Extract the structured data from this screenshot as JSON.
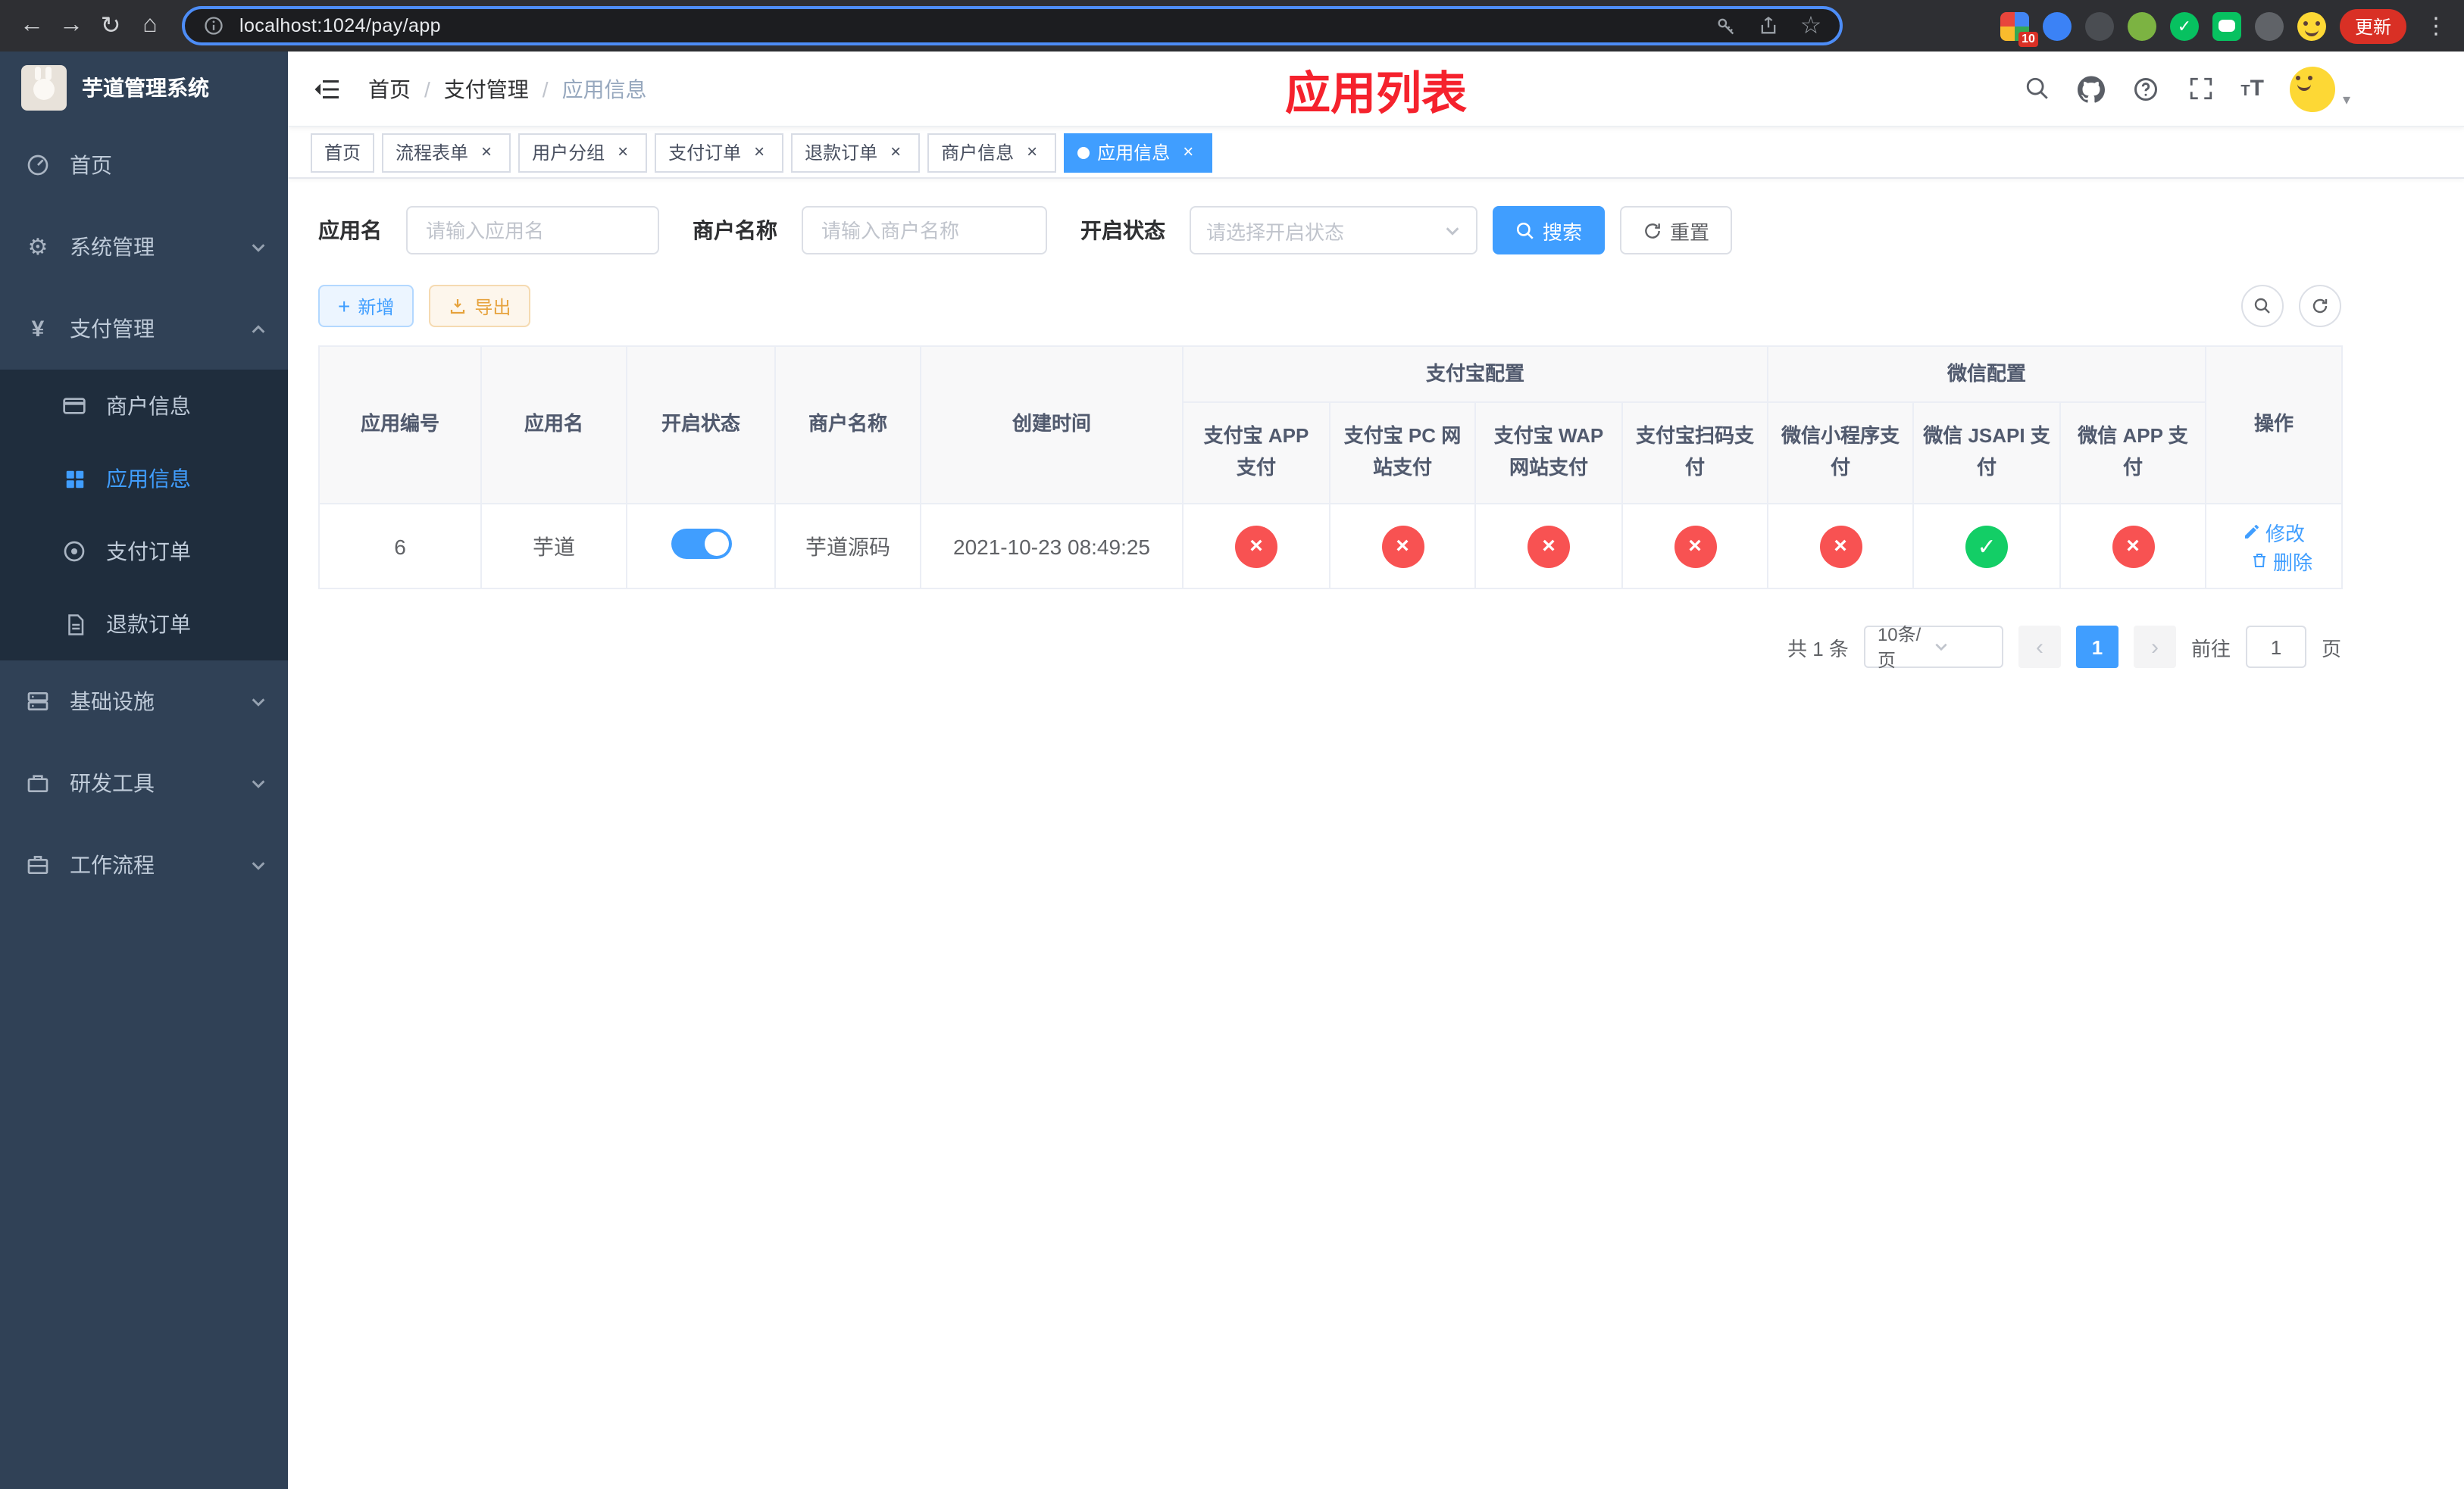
{
  "browser": {
    "url": "localhost:1024/pay/app",
    "ext_badge": "10",
    "update_label": "更新"
  },
  "colors": {
    "accent": "#409eff",
    "danger": "#f85252",
    "success": "#13ce66",
    "warning": "#e6a23c",
    "title_red": "#f5222d",
    "sidebar_bg": "#304156",
    "submenu_bg": "#1f2d3d"
  },
  "sidebar": {
    "title": "芋道管理系统",
    "items": [
      {
        "label": "首页",
        "icon": "dashboard-icon"
      },
      {
        "label": "系统管理",
        "icon": "gear-icon",
        "expandable": true,
        "expanded": false
      },
      {
        "label": "支付管理",
        "icon": "yen-icon",
        "expandable": true,
        "expanded": true,
        "children": [
          {
            "label": "商户信息",
            "icon": "card-icon",
            "active": false
          },
          {
            "label": "应用信息",
            "icon": "grid-icon",
            "active": true
          },
          {
            "label": "支付订单",
            "icon": "order-icon",
            "active": false
          },
          {
            "label": "退款订单",
            "icon": "refund-icon",
            "active": false
          }
        ]
      },
      {
        "label": "基础设施",
        "icon": "infra-icon",
        "expandable": true,
        "expanded": false
      },
      {
        "label": "研发工具",
        "icon": "tools-icon",
        "expandable": true,
        "expanded": false
      },
      {
        "label": "工作流程",
        "icon": "workflow-icon",
        "expandable": true,
        "expanded": false
      }
    ]
  },
  "header": {
    "breadcrumb": [
      "首页",
      "支付管理",
      "应用信息"
    ],
    "page_title": "应用列表"
  },
  "tabs": [
    {
      "label": "首页",
      "closable": false,
      "active": false
    },
    {
      "label": "流程表单",
      "closable": true,
      "active": false
    },
    {
      "label": "用户分组",
      "closable": true,
      "active": false
    },
    {
      "label": "支付订单",
      "closable": true,
      "active": false
    },
    {
      "label": "退款订单",
      "closable": true,
      "active": false
    },
    {
      "label": "商户信息",
      "closable": true,
      "active": false
    },
    {
      "label": "应用信息",
      "closable": true,
      "active": true
    }
  ],
  "filters": {
    "app_name_label": "应用名",
    "app_name_placeholder": "请输入应用名",
    "merchant_label": "商户名称",
    "merchant_placeholder": "请输入商户名称",
    "status_label": "开启状态",
    "status_placeholder": "请选择开启状态",
    "search_label": "搜索",
    "reset_label": "重置"
  },
  "toolbar": {
    "add_label": "新增",
    "export_label": "导出"
  },
  "table": {
    "headers": {
      "app_id": "应用编号",
      "app_name": "应用名",
      "status": "开启状态",
      "merchant": "商户名称",
      "created": "创建时间",
      "alipay_group": "支付宝配置",
      "wechat_group": "微信配置",
      "ops": "操作",
      "alipay_app": "支付宝 APP 支付",
      "alipay_pc": "支付宝 PC 网站支付",
      "alipay_wap": "支付宝 WAP 网站支付",
      "alipay_qr": "支付宝扫码支付",
      "wx_mini": "微信小程序支付",
      "wx_jsapi": "微信 JSAPI 支付",
      "wx_app": "微信 APP 支付"
    },
    "row": {
      "id": "6",
      "name": "芋道",
      "enabled": true,
      "merchant": "芋道源码",
      "created": "2021-10-23 08:49:25",
      "configs": [
        false,
        false,
        false,
        false,
        false,
        true,
        false
      ],
      "edit_label": "修改",
      "delete_label": "删除"
    }
  },
  "pagination": {
    "total_label": "共 1 条",
    "page_size_label": "10条/页",
    "current_page": "1",
    "goto_label": "前往",
    "goto_value": "1",
    "page_suffix": "页"
  }
}
